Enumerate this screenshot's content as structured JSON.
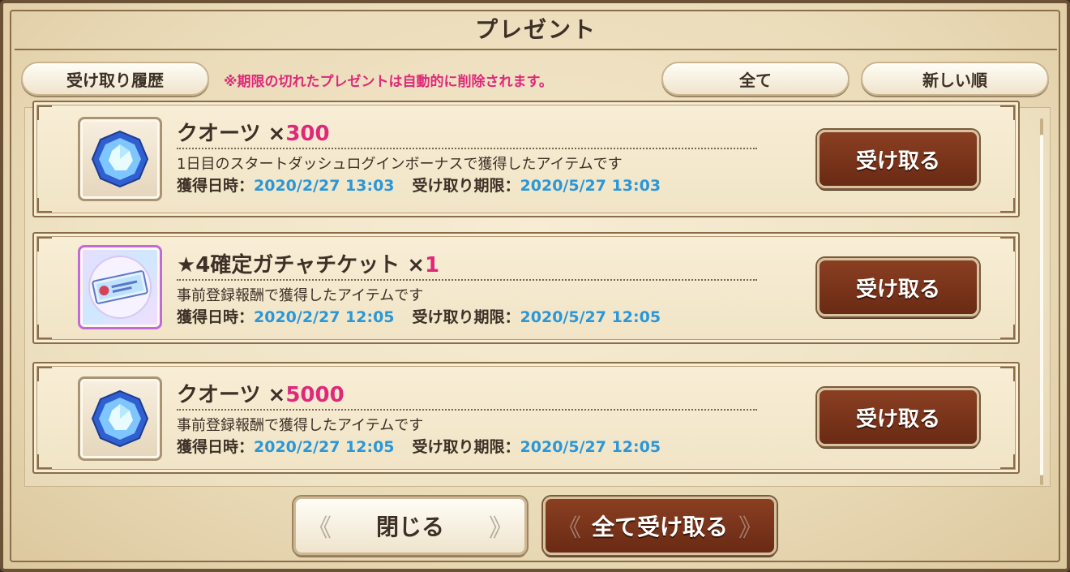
{
  "title": "プレゼント",
  "header": {
    "history_button": "受け取り履歴",
    "notice": "※期限の切れたプレゼントは自動的に削除されます。",
    "filter_button": "全て",
    "sort_button": "新しい順"
  },
  "date_labels": {
    "obtained": "獲得日時：",
    "deadline": "受け取り期限："
  },
  "items": [
    {
      "name": "クオーツ ×",
      "quantity": "300",
      "description": "1日目のスタートダッシュログインボーナスで獲得したアイテムです",
      "obtained": "2020/2/27 13:03",
      "deadline": "2020/5/27 13:03",
      "button": "受け取る",
      "icon": "quartz-crystal-icon"
    },
    {
      "name": "★4確定ガチャチケット ×",
      "quantity": "1",
      "description": "事前登録報酬で獲得したアイテムです",
      "obtained": "2020/2/27 12:05",
      "deadline": "2020/5/27 12:05",
      "button": "受け取る",
      "icon": "gacha-ticket-icon"
    },
    {
      "name": "クオーツ ×",
      "quantity": "5000",
      "description": "事前登録報酬で獲得したアイテムです",
      "obtained": "2020/2/27 12:05",
      "deadline": "2020/5/27 12:05",
      "button": "受け取る",
      "icon": "quartz-crystal-icon"
    }
  ],
  "footer": {
    "close_button": "閉じる",
    "receive_all_button": "全て受け取る"
  },
  "colors": {
    "accent_pink": "#e0287a",
    "date_blue": "#2a97d8",
    "button_brown": "#7a3219"
  }
}
